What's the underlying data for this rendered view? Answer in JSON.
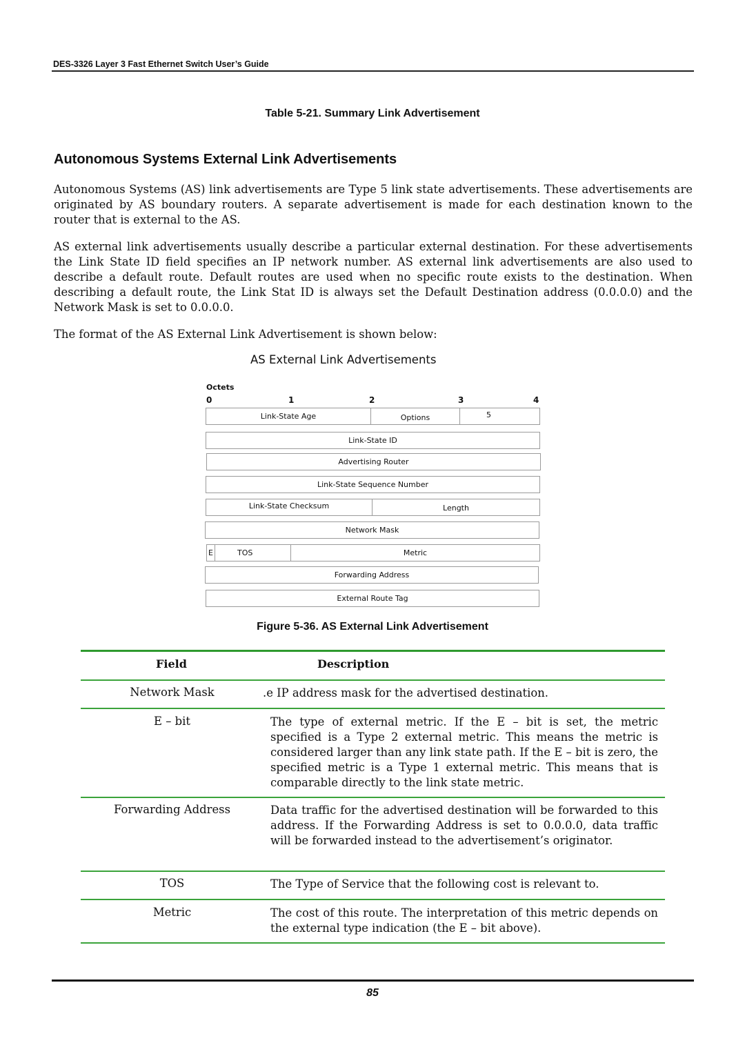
{
  "header": {
    "title": "DES-3326 Layer 3 Fast Ethernet Switch User’s Guide"
  },
  "previous_table_caption": "Table 5-21.  Summary Link Advertisement",
  "section": {
    "title": "Autonomous Systems External Link Advertisements",
    "paragraphs": [
      "Autonomous Systems (AS) link advertisements are Type 5 link state advertisements. These advertisements are originated by AS boundary routers. A separate advertisement is made for each destination known to the router that is external to the AS.",
      "AS external link advertisements usually describe a particular external destination. For these advertisements the Link State ID field specifies an IP network number. AS external link advertisements are also used to describe a default route. Default routes are used when no specific route exists to the destination. When describing a default route, the Link Stat ID is always set the Default Destination address (0.0.0.0) and the Network Mask is set to 0.0.0.0.",
      "The format of the AS External Link Advertisement is shown below:"
    ]
  },
  "figure": {
    "title": "AS External Link Advertisements",
    "octets_label": "Octets",
    "octet_numbers": [
      "0",
      "1",
      "2",
      "3",
      "4"
    ],
    "rows": [
      [
        "Link-State Age",
        "Options",
        "5"
      ],
      [
        "Link-State ID"
      ],
      [
        "Advertising Router"
      ],
      [
        "Link-State Sequence Number"
      ],
      [
        "Link-State Checksum",
        "Length"
      ],
      [
        "Network Mask"
      ],
      [
        "E",
        "TOS",
        "Metric"
      ],
      [
        "Forwarding Address"
      ],
      [
        "External Route Tag"
      ]
    ],
    "caption": "Figure 5-36.  AS External Link Advertisement"
  },
  "table": {
    "headers": {
      "field": "Field",
      "description": "Description"
    },
    "rows": [
      {
        "field": "Network Mask",
        "description": ".e IP address mask for the advertised destination."
      },
      {
        "field": "E – bit",
        "description": "The type of external metric. If the E – bit is set, the metric specified is a Type 2 external metric. This means the metric is considered larger than any link state path. If the E – bit is zero, the specified metric is a Type 1 external metric. This means that is comparable directly to the link state metric."
      },
      {
        "field": "Forwarding Address",
        "description": "Data traffic for the advertised destination will be forwarded to this address. If the Forwarding Address is set to 0.0.0.0, data traffic will be forwarded instead to the advertisement’s originator."
      },
      {
        "field": "TOS",
        "description": "The Type of Service that the following cost is relevant to."
      },
      {
        "field": "Metric",
        "description": "The cost of this route. The interpretation of this metric depends on the external type indication (the E – bit above)."
      }
    ]
  },
  "footer": {
    "page_number": "85"
  }
}
